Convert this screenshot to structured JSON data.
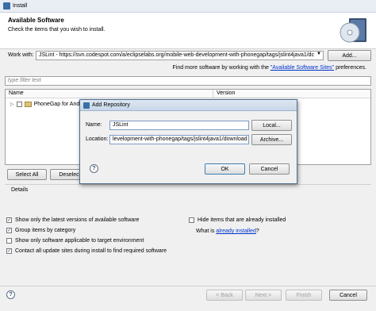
{
  "window": {
    "title": "Install"
  },
  "header": {
    "title": "Available Software",
    "subtitle": "Check the items that you wish to install."
  },
  "work_with": {
    "label": "Work with:",
    "value": "JSLint - https://svn.codespot.com/a/eclipselabs.org/mobile-web-development-with-phonegap/tags/jslint4java1/dc",
    "add_label": "Add...",
    "find_more_prefix": "Find more software by working with the ",
    "find_more_link": "\"Available Software Sites\"",
    "find_more_suffix": " preferences."
  },
  "filter": {
    "placeholder": "type filter text"
  },
  "table": {
    "columns": [
      "Name",
      "Version"
    ],
    "rows": [
      {
        "name": "PhoneGap for And"
      }
    ]
  },
  "buttons": {
    "select_all": "Select All",
    "deselect": "Deselect"
  },
  "details": {
    "label": "Details"
  },
  "options": {
    "latest_versions": {
      "label": "Show only the latest versions of available software",
      "checked": true
    },
    "group_by_category": {
      "label": "Group items by category",
      "checked": true
    },
    "applicable_only": {
      "label": "Show only software applicable to target environment",
      "checked": false
    },
    "contact_sites": {
      "label": "Contact all update sites during install to find required software",
      "checked": true
    },
    "hide_installed": {
      "label": "Hide items that are already installed",
      "checked": false
    },
    "what_is_prefix": "What is ",
    "already_installed_link": "already installed",
    "what_is_suffix": "?"
  },
  "footer": {
    "back": "< Back",
    "next": "Next >",
    "finish": "Finish",
    "cancel": "Cancel"
  },
  "dialog": {
    "title": "Add Repository",
    "name_label": "Name:",
    "name_value": "JSLint",
    "local_label": "Local...",
    "location_label": "Location:",
    "location_value": "levelopment-with-phonegap/tags/jslint4java1/download",
    "archive_label": "Archive...",
    "ok_label": "OK",
    "cancel_label": "Cancel"
  }
}
